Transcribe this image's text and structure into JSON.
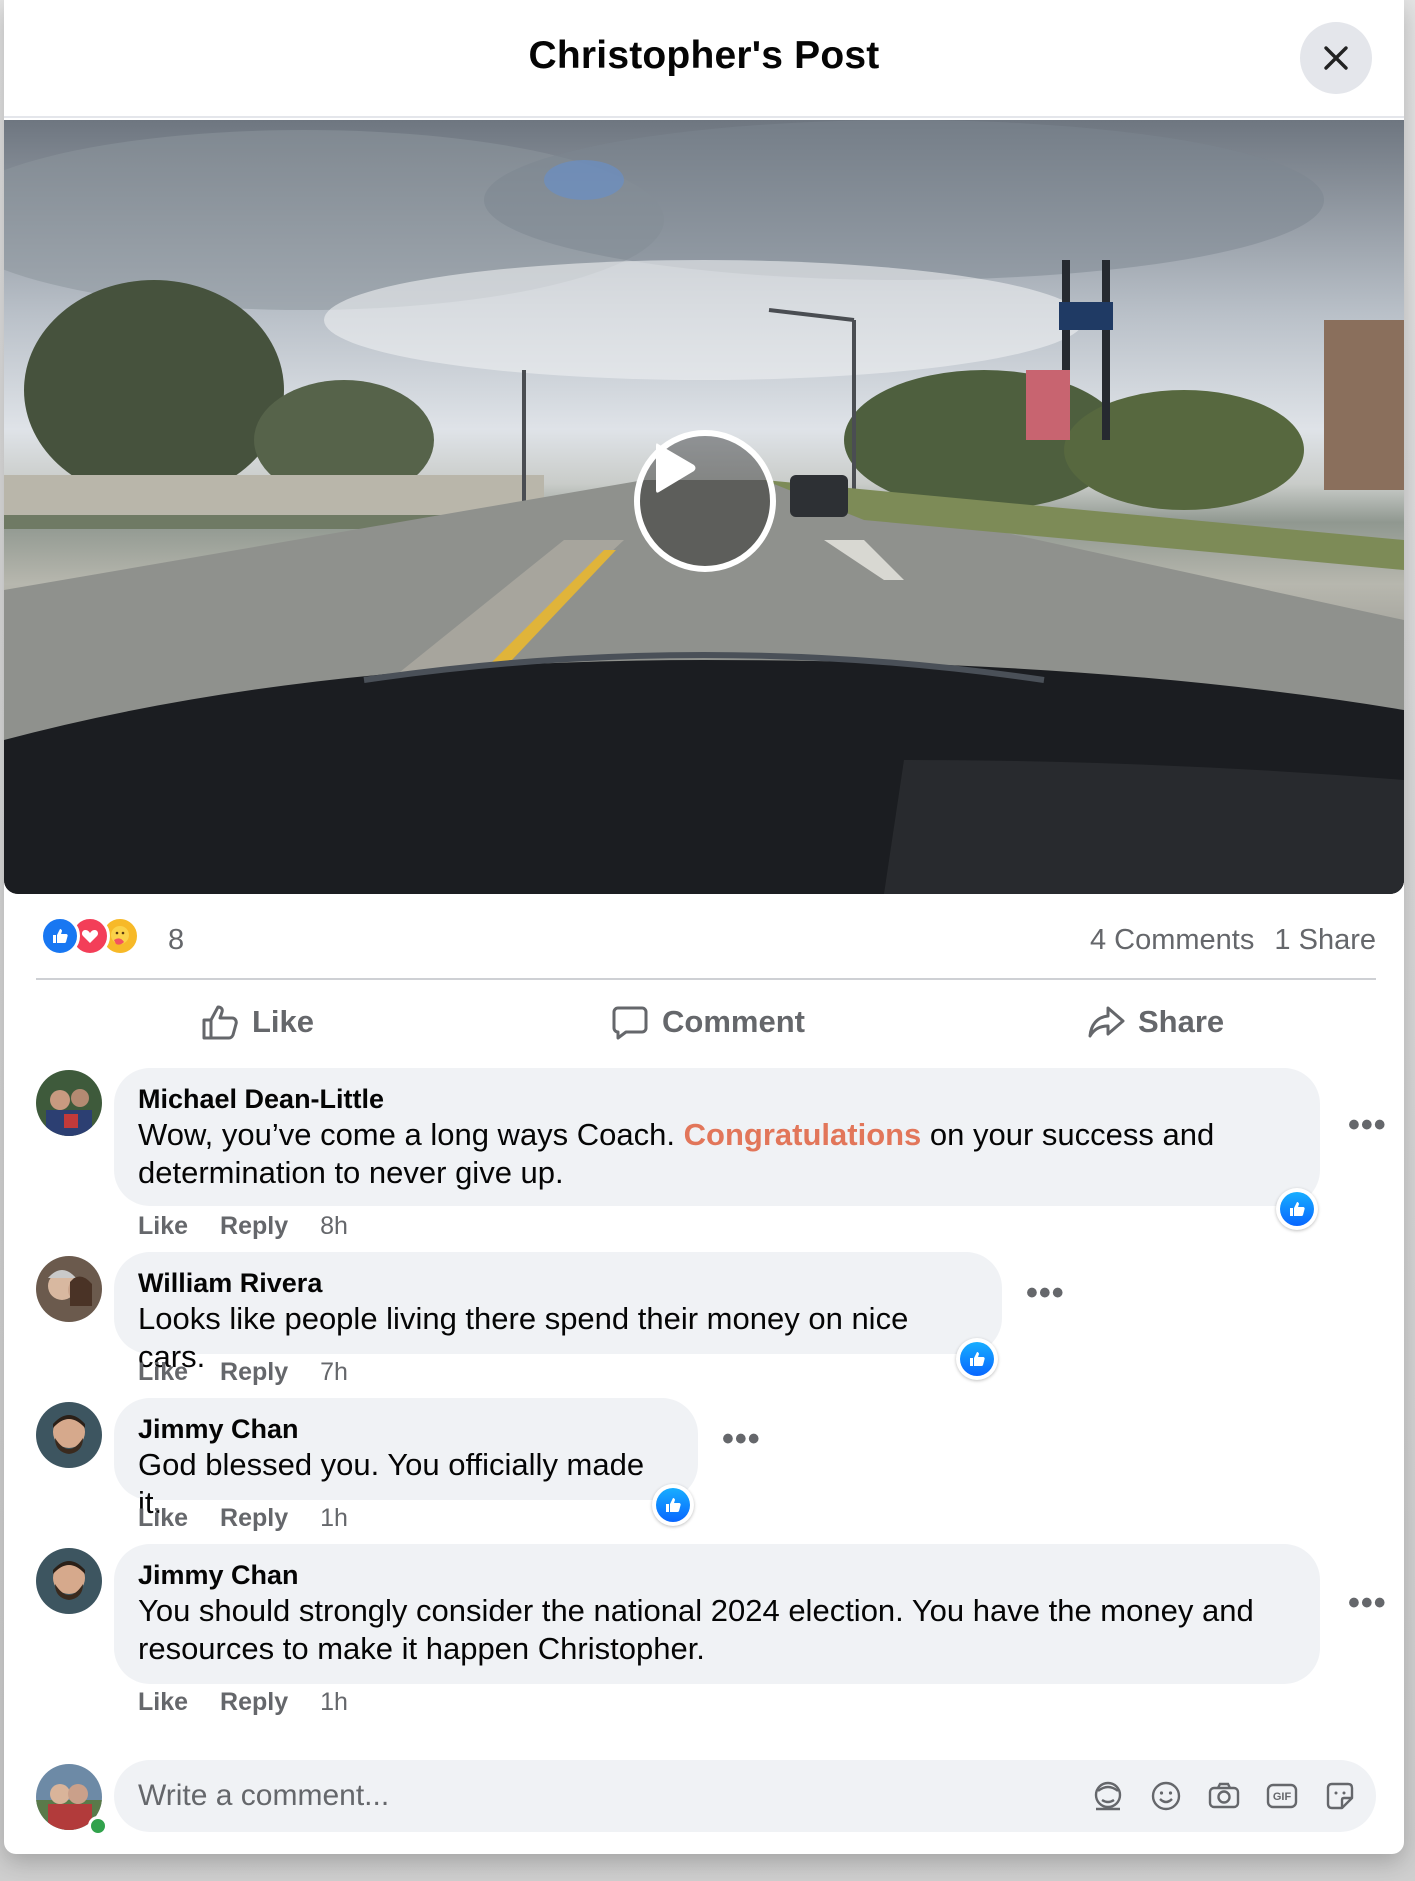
{
  "dialog": {
    "title": "Christopher's Post",
    "close_icon": "close-icon"
  },
  "video": {
    "play_icon": "play-icon"
  },
  "stats": {
    "reaction_icons": [
      "like-reaction-icon",
      "love-reaction-icon",
      "care-reaction-icon"
    ],
    "reaction_count": "8",
    "comments": "4 Comments",
    "shares": "1 Share"
  },
  "actions": {
    "like": "Like",
    "comment": "Comment",
    "share": "Share"
  },
  "comments": [
    {
      "author": "Michael Dean-Little",
      "text_before": "Wow, you’ve come a long ways Coach. ",
      "text_highlight": "Congratulations",
      "text_after": " on your success and determination to never give up.",
      "like": "Like",
      "reply": "Reply",
      "time": "8h",
      "has_like_reaction": true
    },
    {
      "author": "William Rivera",
      "text": "Looks like people living there spend their money on nice cars.",
      "like": "Like",
      "reply": "Reply",
      "time": "7h",
      "has_like_reaction": true
    },
    {
      "author": "Jimmy Chan",
      "text": "God blessed you. You officially made it.",
      "like": "Like",
      "reply": "Reply",
      "time": "1h",
      "has_like_reaction": true
    },
    {
      "author": "Jimmy Chan",
      "text": "You should strongly consider the national 2024 election. You have the money and resources to make it happen Christopher.",
      "like": "Like",
      "reply": "Reply",
      "time": "1h",
      "has_like_reaction": false
    }
  ],
  "composer": {
    "placeholder": "Write a comment...",
    "tools": [
      "avatar-sticker-icon",
      "emoji-icon",
      "camera-icon",
      "gif-icon",
      "sticker-icon"
    ],
    "gif_label": "GIF"
  },
  "colors": {
    "accent_blue": "#0866ff",
    "highlight": "#e2765a",
    "secondary_text": "#65676b",
    "bubble_bg": "#f0f2f5"
  }
}
